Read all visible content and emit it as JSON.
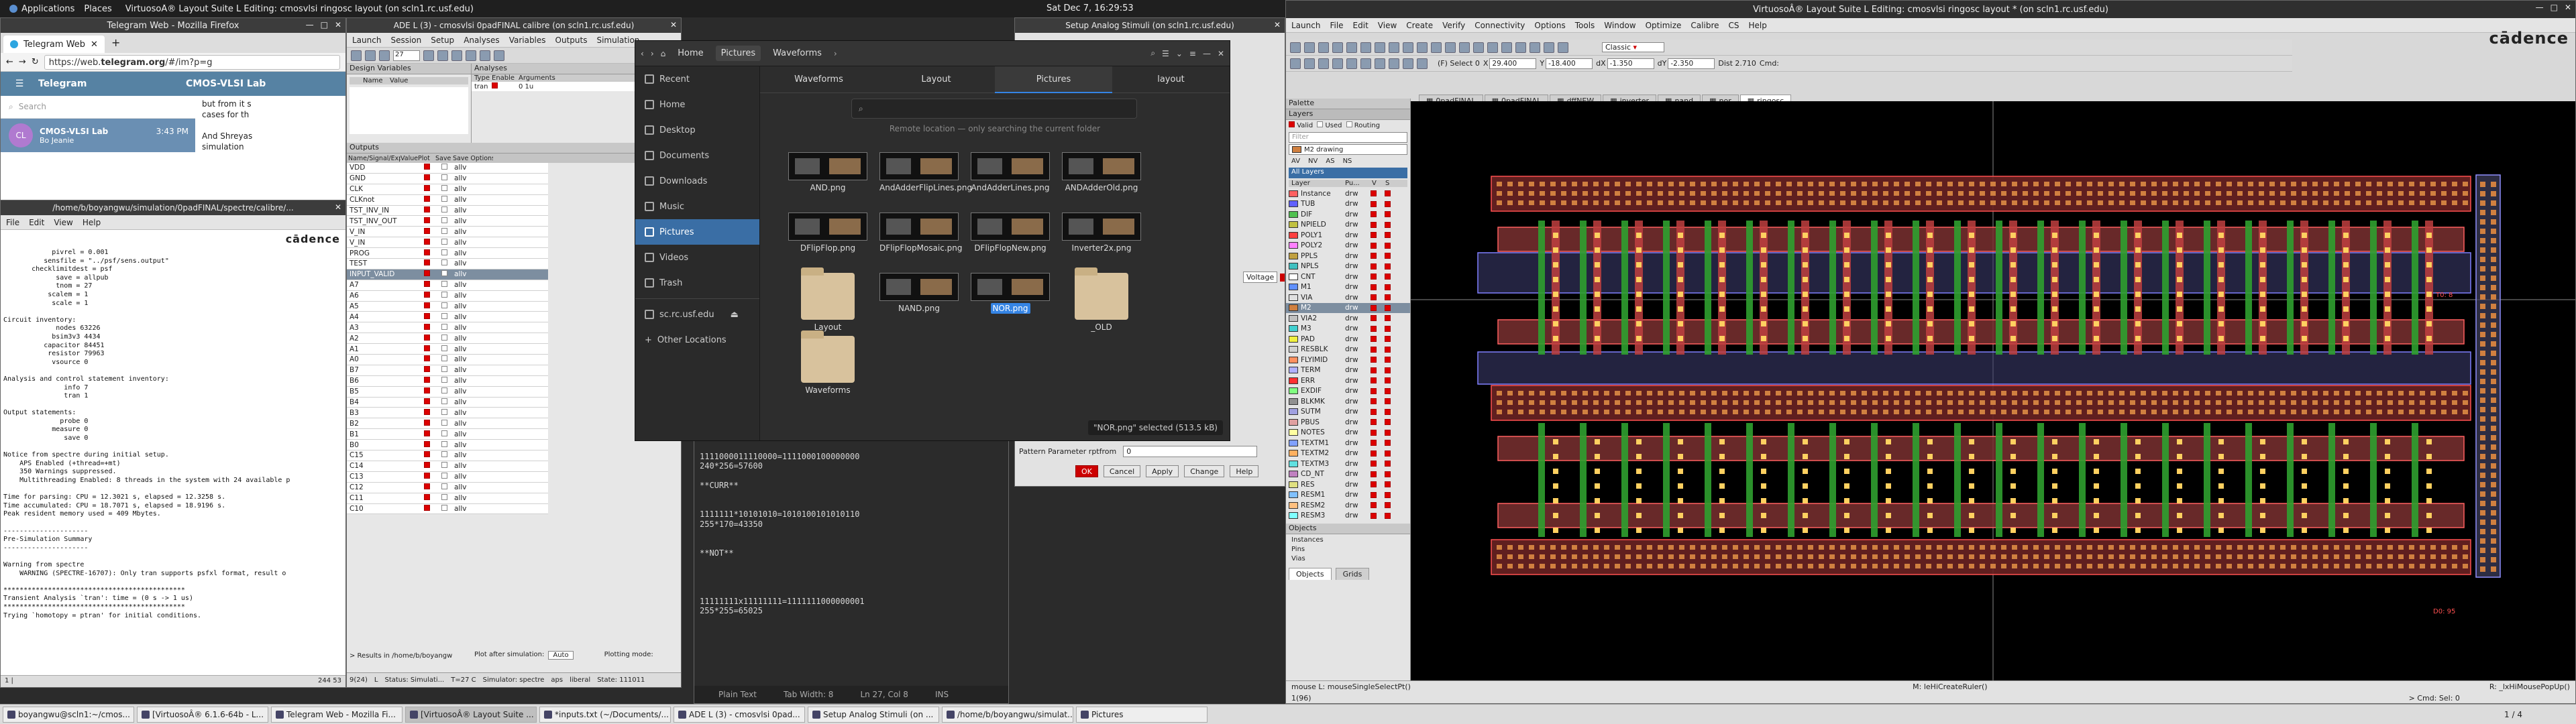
{
  "panel": {
    "applications": "Applications",
    "places": "Places",
    "active_window": "VirtuosoÂ® Layout Suite L Editing: cmosvlsi ringosc layout (on scln1.rc.usf.edu)",
    "clock": "Sat Dec 7, 16:29:53"
  },
  "telegram": {
    "window_title": "Telegram Web - Mozilla Firefox",
    "tab_label": "Telegram Web",
    "url_prefix": "https://web.",
    "url_domain": "telegram.org",
    "url_rest": "/#/im?p=g",
    "app_name": "Telegram",
    "chat_title": "CMOS-VLSI Lab",
    "search_placeholder": "Search",
    "chat_item_name": "CMOS-VLSI Lab",
    "chat_item_time": "3:43 PM",
    "chat_item_preview": "Bo Jeanie",
    "avatar": "CL",
    "msg1": "but from it s",
    "msg2": "cases for th",
    "msg3": "And Shreyas",
    "msg4": "simulation"
  },
  "spectre": {
    "window_title": "/home/b/boyangwu/simulation/0padFINAL/spectre/calibre/...",
    "menu": [
      "File",
      "Edit",
      "View",
      "Help"
    ],
    "brand": "cādence",
    "log": "            pivrel = 0.001\n          sensfile = \"../psf/sens.output\"\n       checklimitdest = psf\n             save = allpub\n             tnom = 27\n           scalem = 1\n            scale = 1\n\nCircuit inventory:\n             nodes 63226\n            bsim3v3 4434\n          capacitor 84451\n           resistor 79963\n            vsource 0\n\nAnalysis and control statement inventory:\n               info 7\n               tran 1\n\nOutput statements:\n              probe 0\n            measure 0\n               save 0\n\nNotice from spectre during initial setup.\n    APS Enabled (+thread=+mt) \n    350 Warnings suppressed.\n    Multithreading Enabled: 8 threads in the system with 24 available p\n\nTime for parsing: CPU = 12.3021 s, elapsed = 12.3258 s.\nTime accumulated: CPU = 18.7071 s, elapsed = 18.9196 s.\nPeak resident memory used = 409 Mbytes.\n\n---------------------\nPre-Simulation Summary\n---------------------\n\nWarning from spectre\n    WARNING (SPECTRE-16707): Only tran supports psfxl format, result o\n\n*********************************************\nTransient Analysis `tran': time = (0 s -> 1 us)\n*********************************************\nTrying `homotopy = ptran' for initial conditions.",
    "status_left": "1 |",
    "status_right": "244      53"
  },
  "ade": {
    "window_title": "ADE L (3) - cmosvlsi 0padFINAL calibre (on scln1.rc.usf.edu)",
    "menu": [
      "Launch",
      "Session",
      "Setup",
      "Analyses",
      "Variables",
      "Outputs",
      "Simulation"
    ],
    "temp_value": "27",
    "design_vars_label": "Design Variables",
    "dv_cols": [
      "Name",
      "Value"
    ],
    "analyses_label": "Analyses",
    "an_cols": [
      "Type",
      "Enable",
      "Arguments"
    ],
    "an_row": {
      "type": "tran",
      "arg": "0 1u"
    },
    "outputs_label": "Outputs",
    "out_cols": [
      "Name/Signal/Expr",
      "Value",
      "Plot",
      "Save",
      "Save Options"
    ],
    "outputs": [
      "VDD",
      "GND",
      "CLK",
      "CLKnot",
      "TST_INV_IN",
      "TST_INV_OUT",
      "V_IN",
      "V_IN",
      "PROG",
      "TEST",
      "INPUT_VALID",
      "A7",
      "A6",
      "A5",
      "A4",
      "A3",
      "A2",
      "A1",
      "A0",
      "B7",
      "B6",
      "B5",
      "B4",
      "B3",
      "B2",
      "B1",
      "B0",
      "C15",
      "C14",
      "C13",
      "C12",
      "C11",
      "C10"
    ],
    "selected_output": "INPUT_VALID",
    "save_label": "allv",
    "results_label": "> Results in /home/b/boyangw",
    "plot_after": "Plot after simulation:",
    "plot_after_val": "Auto",
    "plotting_mode": "Plotting mode:",
    "status": [
      "9(24)",
      "L",
      "Status: Simulati...",
      "T=27 C",
      "Simulator: spectre",
      "aps",
      "liberal",
      "State: 111011"
    ]
  },
  "files": {
    "title": "Pictures",
    "crumbs": [
      "Home",
      "Pictures",
      "Waveforms"
    ],
    "sidebar": [
      "Recent",
      "Home",
      "Desktop",
      "Documents",
      "Downloads",
      "Music",
      "Pictures",
      "Videos",
      "Trash",
      "sc.rc.usf.edu",
      "Other Locations"
    ],
    "tabs": [
      "Waveforms",
      "Layout",
      "Pictures",
      "layout"
    ],
    "search_note": "Remote location — only searching the current folder",
    "items": [
      {
        "name": "AND.png",
        "kind": "img"
      },
      {
        "name": "AndAdderFlipLines.png",
        "kind": "img"
      },
      {
        "name": "AndAdderLines.png",
        "kind": "img"
      },
      {
        "name": "ANDAdderOld.png",
        "kind": "img"
      },
      {
        "name": "DFlipFlop.png",
        "kind": "img"
      },
      {
        "name": "DFlipFlopMosaic.png",
        "kind": "img"
      },
      {
        "name": "DFlipFlopNew.png",
        "kind": "img"
      },
      {
        "name": "Inverter2x.png",
        "kind": "img"
      },
      {
        "name": "Layout",
        "kind": "folder"
      },
      {
        "name": "NAND.png",
        "kind": "img"
      },
      {
        "name": "NOR.png",
        "kind": "img"
      },
      {
        "name": "_OLD",
        "kind": "folder"
      },
      {
        "name": "Waveforms",
        "kind": "folder"
      }
    ],
    "selected": "NOR.png",
    "status": "\"NOR.png\" selected (513.5 kB)"
  },
  "editor": {
    "text": "255*256=65536\n\n1111000011110000=1111000100000000\n240*256=57600\n\n**CURR**\n\n\n1111111*10101010=1010100101010110\n255*170=43350\n\n\n**NOT**\n\n\n\n\n11111111x11111111=1111111000000001\n255*255=65025",
    "status": [
      "Plain Text",
      "Tab Width: 8",
      "Ln 27, Col 8",
      "INS"
    ]
  },
  "stimuli": {
    "window_title": "Setup Analog Stimuli (on scln1.rc.usf.edu)",
    "voltage_label": "Voltage",
    "pattern_label": "Pattern Parameter rptfrom",
    "pattern_val": "0",
    "buttons": [
      "OK",
      "Cancel",
      "Apply",
      "Change",
      "Help"
    ]
  },
  "layout": {
    "window_title": "VirtuosoÂ® Layout Suite L Editing: cmosvlsi ringosc layout * (on scln1.rc.usf.edu)",
    "menu": [
      "Launch",
      "File",
      "Edit",
      "View",
      "Create",
      "Verify",
      "Connectivity",
      "Options",
      "Tools",
      "Window",
      "Optimize",
      "Calibre",
      "CS",
      "Help"
    ],
    "brand": "cādence",
    "workspace": "Classic",
    "coords": {
      "x": "29.400",
      "y": "-18.400",
      "dx": "-1.350",
      "dy": "-2.350",
      "dist": "Dist 2.710",
      "cmd": "Cmd:"
    },
    "sel_info": "(F) Select 0",
    "tabs": [
      "0padFINAL",
      "0padFINAL",
      "dffNEW",
      "inverter",
      "nand",
      "nor",
      "ringosc"
    ],
    "palette_title": "Palette",
    "layers_title": "Layers",
    "filter_opts": [
      "Valid",
      "Used",
      "Routing"
    ],
    "filter_placeholder": "Filter",
    "lpp": "M2 drawing",
    "avnv": [
      "AV",
      "NV",
      "AS",
      "NS"
    ],
    "all_layers": "All Layers",
    "layer_cols": [
      "Layer",
      "Pu...",
      "V",
      "S"
    ],
    "layers": [
      {
        "n": "Instance",
        "p": "drw",
        "c": "#ff6060"
      },
      {
        "n": "TUB",
        "p": "drw",
        "c": "#6060ff"
      },
      {
        "n": "DIF",
        "p": "drw",
        "c": "#50c050"
      },
      {
        "n": "NPIELD",
        "p": "drw",
        "c": "#c0c040"
      },
      {
        "n": "POLY1",
        "p": "drw",
        "c": "#ff4040"
      },
      {
        "n": "POLY2",
        "p": "drw",
        "c": "#ff80ff"
      },
      {
        "n": "PPLS",
        "p": "drw",
        "c": "#c0a040"
      },
      {
        "n": "NPLS",
        "p": "drw",
        "c": "#40c0c0"
      },
      {
        "n": "CNT",
        "p": "drw",
        "c": "#ffffff"
      },
      {
        "n": "M1",
        "p": "drw",
        "c": "#6090ff"
      },
      {
        "n": "VIA",
        "p": "drw",
        "c": "#e0e0e0"
      },
      {
        "n": "M2",
        "p": "drw",
        "c": "#d08040"
      },
      {
        "n": "VIA2",
        "p": "drw",
        "c": "#c0c0c0"
      },
      {
        "n": "M3",
        "p": "drw",
        "c": "#40d0d0"
      },
      {
        "n": "PAD",
        "p": "drw",
        "c": "#f0f040"
      },
      {
        "n": "RESBLK",
        "p": "drw",
        "c": "#d0d0d0"
      },
      {
        "n": "FLYIMID",
        "p": "drw",
        "c": "#ff9060"
      },
      {
        "n": "TERM",
        "p": "drw",
        "c": "#b0b0ff"
      },
      {
        "n": "ERR",
        "p": "drw",
        "c": "#ff3030"
      },
      {
        "n": "EXDIF",
        "p": "drw",
        "c": "#80ff80"
      },
      {
        "n": "BLKMK",
        "p": "drw",
        "c": "#909090"
      },
      {
        "n": "SUTM",
        "p": "drw",
        "c": "#a0a0e0"
      },
      {
        "n": "PBUS",
        "p": "drw",
        "c": "#e0a0a0"
      },
      {
        "n": "NOTES",
        "p": "drw",
        "c": "#ffffa0"
      },
      {
        "n": "TEXTM1",
        "p": "drw",
        "c": "#80a0ff"
      },
      {
        "n": "TEXTM2",
        "p": "drw",
        "c": "#ffb060"
      },
      {
        "n": "TEXTM3",
        "p": "drw",
        "c": "#60e0e0"
      },
      {
        "n": "CD_NT",
        "p": "drw",
        "c": "#c080c0"
      },
      {
        "n": "RES",
        "p": "drw",
        "c": "#e0e080"
      },
      {
        "n": "RESM1",
        "p": "drw",
        "c": "#80c0ff"
      },
      {
        "n": "RESM2",
        "p": "drw",
        "c": "#ffc080"
      },
      {
        "n": "RESM3",
        "p": "drw",
        "c": "#80ffff"
      }
    ],
    "objects_title": "Objects",
    "objects": [
      "Instances",
      "Pins",
      "Vias"
    ],
    "bottom_tabs": [
      "Objects",
      "Grids"
    ],
    "canvas_labels": {
      "top": "T0: 8",
      "bot": "D0: 95"
    },
    "status": {
      "mouse_l": "mouse L: mouseSingleSelectPt()",
      "mouse_m": "M: leHiCreateRuler()",
      "mouse_r": "R: _lxHiMousePopUp()",
      "line": "1(96)",
      "cmd": "> Cmd: Sel: 0"
    }
  },
  "taskbar": {
    "items": [
      "boyangwu@scln1:~/cmos...",
      "[VirtuosoÂ® 6.1.6-64b - L...",
      "Telegram Web - Mozilla Fi...",
      "[VirtuosoÂ® Layout Suite ...",
      "*inputs.txt (~/Documents/...",
      "ADE L (3) - cmosvlsi 0pad...",
      "Setup Analog Stimuli (on ...",
      "/home/b/boyangwu/simulat...",
      "Pictures"
    ],
    "active": "[VirtuosoÂ® Layout Suite ...",
    "pager": "1 / 4"
  },
  "colors": {
    "accent": "#3584e4",
    "telegram": "#5682a3",
    "cadence_red": "#c00000"
  }
}
